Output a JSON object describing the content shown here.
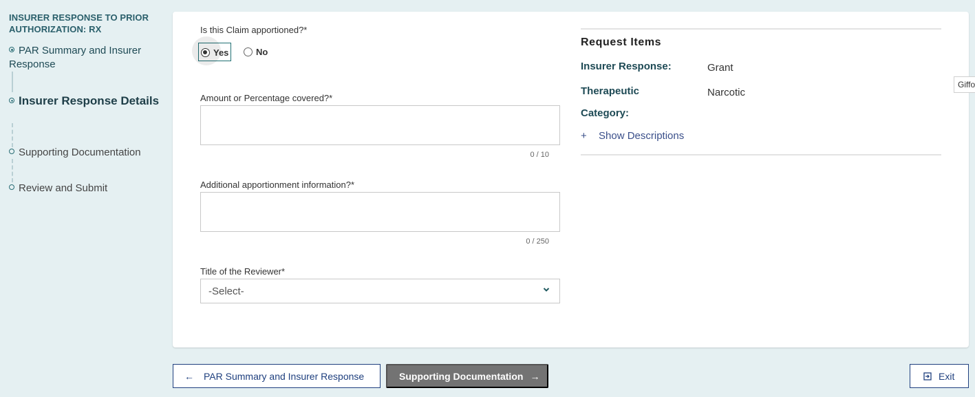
{
  "sidebar": {
    "title": "INSURER RESPONSE TO PRIOR AUTHORIZATION: RX",
    "steps": [
      {
        "label": "PAR Summary and Insurer Response",
        "state": "completed",
        "icon": "radio-filled-icon"
      },
      {
        "label": "Insurer Response Details",
        "state": "current",
        "icon": "plus-circle-icon"
      },
      {
        "label": "Supporting Documentation",
        "state": "upcoming",
        "icon": "circle-outline-icon"
      },
      {
        "label": "Review and Submit",
        "state": "upcoming",
        "icon": "circle-outline-icon"
      }
    ]
  },
  "form": {
    "apportioned": {
      "label": "Is this Claim apportioned?*",
      "options": [
        {
          "label": "Yes",
          "selected": true
        },
        {
          "label": "No",
          "selected": false
        }
      ]
    },
    "amount": {
      "label": "Amount or Percentage covered?*",
      "value": "",
      "counter": "0 / 10"
    },
    "additional_info": {
      "label": "Additional apportionment information?*",
      "value": "",
      "counter": "0 / 250"
    },
    "reviewer_title": {
      "label": "Title of the Reviewer*",
      "selected": "-Select-"
    }
  },
  "request_items": {
    "title": "Request Items",
    "rows": [
      {
        "key": "Insurer Response:",
        "value": "Grant"
      },
      {
        "key": "Therapeutic Category:",
        "key_line1": "Therapeutic",
        "key_line2": "Category:",
        "value": "Narcotic"
      }
    ],
    "show_descriptions": {
      "icon": "+",
      "label": "Show Descriptions"
    }
  },
  "tooltip": {
    "text": "Giffo"
  },
  "footer": {
    "back_button": {
      "icon": "←",
      "label": "PAR Summary and Insurer Response"
    },
    "next_button": {
      "icon": "→",
      "label": "Supporting Documentation"
    },
    "exit_button": {
      "icon": "⇥",
      "label": "Exit"
    }
  },
  "colors": {
    "background": "#e5f0f2",
    "accent_teal": "#1f6f73",
    "nav_blue": "#1e3f7e",
    "disabled_gray": "#737373"
  }
}
